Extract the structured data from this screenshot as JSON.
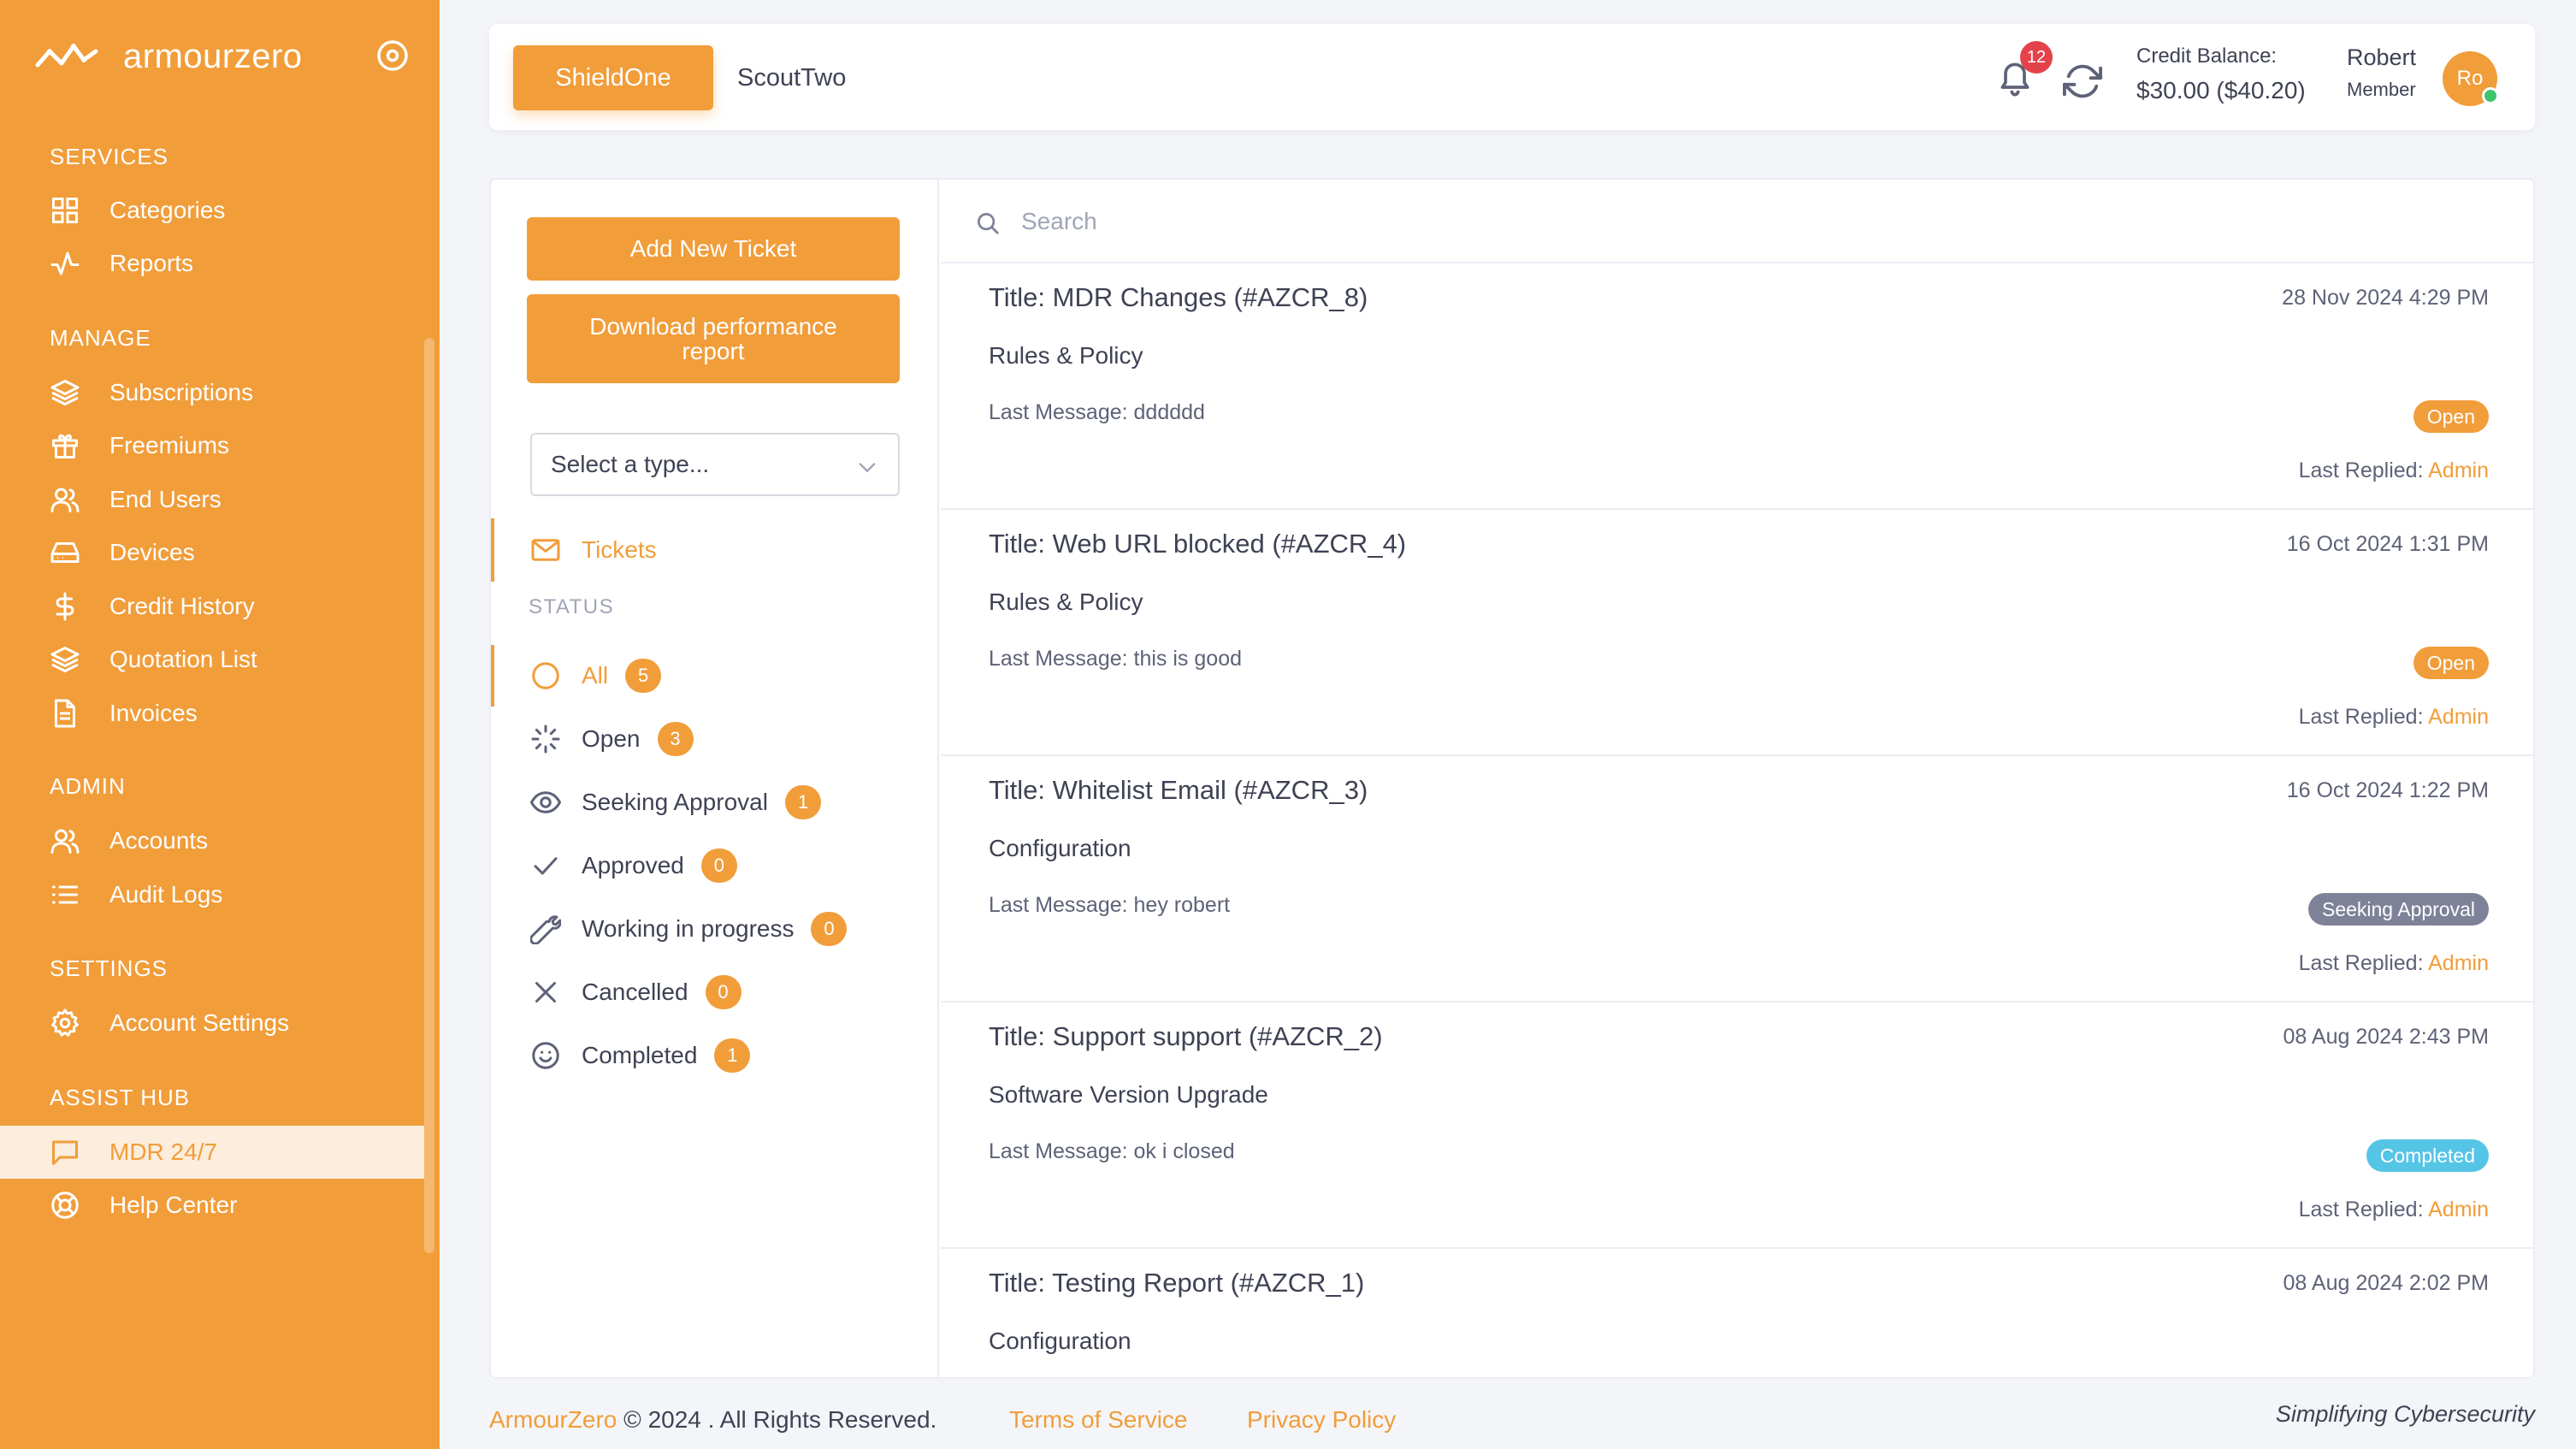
{
  "colors": {
    "accent": "#f19d3a",
    "open": "#f19d3a",
    "seeking": "#7e8299",
    "completed": "#55c5e6",
    "notification": "#e3424b",
    "online": "#3ec46d"
  },
  "brand": {
    "name": "armourzero"
  },
  "sidebar": {
    "sections": [
      {
        "title": "SERVICES",
        "items": [
          {
            "label": "Categories",
            "icon": "grid-icon"
          },
          {
            "label": "Reports",
            "icon": "activity-icon"
          }
        ]
      },
      {
        "title": "MANAGE",
        "items": [
          {
            "label": "Subscriptions",
            "icon": "layers-icon"
          },
          {
            "label": "Freemiums",
            "icon": "gift-icon"
          },
          {
            "label": "End Users",
            "icon": "users-icon"
          },
          {
            "label": "Devices",
            "icon": "hard-drive-icon"
          },
          {
            "label": "Credit History",
            "icon": "dollar-icon"
          },
          {
            "label": "Quotation List",
            "icon": "layers-icon"
          },
          {
            "label": "Invoices",
            "icon": "file-text-icon"
          }
        ]
      },
      {
        "title": "ADMIN",
        "items": [
          {
            "label": "Accounts",
            "icon": "users-icon"
          },
          {
            "label": "Audit Logs",
            "icon": "list-icon"
          }
        ]
      },
      {
        "title": "SETTINGS",
        "items": [
          {
            "label": "Account Settings",
            "icon": "gear-icon"
          }
        ]
      },
      {
        "title": "ASSIST HUB",
        "items": [
          {
            "label": "MDR 24/7",
            "icon": "message-icon",
            "active": true
          },
          {
            "label": "Help Center",
            "icon": "life-buoy-icon"
          }
        ]
      }
    ]
  },
  "topbar": {
    "tabs": [
      {
        "label": "ShieldOne",
        "active": true
      },
      {
        "label": "ScoutTwo",
        "active": false
      }
    ],
    "notifications": "12",
    "credit_label": "Credit Balance:",
    "credit_value": "$30.00 ($40.20)",
    "user": {
      "name": "Robert",
      "role": "Member",
      "initials": "Ro"
    }
  },
  "actions": {
    "add_ticket": "Add New Ticket",
    "download_report_line1": "Download performance",
    "download_report_line2": "report"
  },
  "type_select": {
    "placeholder": "Select a type..."
  },
  "nav": {
    "tickets_label": "Tickets"
  },
  "status": {
    "title": "STATUS",
    "filters": [
      {
        "label": "All",
        "count": "5",
        "icon": "circle-icon",
        "active": true
      },
      {
        "label": "Open",
        "count": "3",
        "icon": "loader-icon"
      },
      {
        "label": "Seeking Approval",
        "count": "1",
        "icon": "eye-icon"
      },
      {
        "label": "Approved",
        "count": "0",
        "icon": "check-icon"
      },
      {
        "label": "Working in progress",
        "count": "0",
        "icon": "wrench-icon"
      },
      {
        "label": "Cancelled",
        "count": "0",
        "icon": "x-icon"
      },
      {
        "label": "Completed",
        "count": "1",
        "icon": "smile-icon"
      }
    ]
  },
  "search": {
    "placeholder": "Search"
  },
  "tickets": [
    {
      "title": "Title: MDR Changes (#AZCR_8)",
      "date": "28 Nov 2024 4:29 PM",
      "category": "Rules & Policy",
      "last_message": "Last Message: dddddd",
      "status": "Open",
      "status_color": "#f19d3a",
      "replied_label": "Last Replied:",
      "replied_by": "Admin"
    },
    {
      "title": "Title: Web URL blocked (#AZCR_4)",
      "date": "16 Oct 2024 1:31 PM",
      "category": "Rules & Policy",
      "last_message": "Last Message: this is good",
      "status": "Open",
      "status_color": "#f19d3a",
      "replied_label": "Last Replied:",
      "replied_by": "Admin"
    },
    {
      "title": "Title: Whitelist Email (#AZCR_3)",
      "date": "16 Oct 2024 1:22 PM",
      "category": "Configuration",
      "last_message": "Last Message: hey robert",
      "status": "Seeking Approval",
      "status_color": "#7e8299",
      "replied_label": "Last Replied:",
      "replied_by": "Admin"
    },
    {
      "title": "Title: Support support (#AZCR_2)",
      "date": "08 Aug 2024 2:43 PM",
      "category": "Software Version Upgrade",
      "last_message": "Last Message: ok i closed",
      "status": "Completed",
      "status_color": "#55c5e6",
      "replied_label": "Last Replied:",
      "replied_by": "Admin"
    },
    {
      "title": "Title: Testing Report (#AZCR_1)",
      "date": "08 Aug 2024 2:02 PM",
      "category": "Configuration"
    }
  ],
  "footer": {
    "brand": "ArmourZero",
    "copyright": " © 2024 . All Rights Reserved.",
    "terms": "Terms of Service",
    "privacy": "Privacy Policy",
    "tagline": "Simplifying Cybersecurity"
  }
}
